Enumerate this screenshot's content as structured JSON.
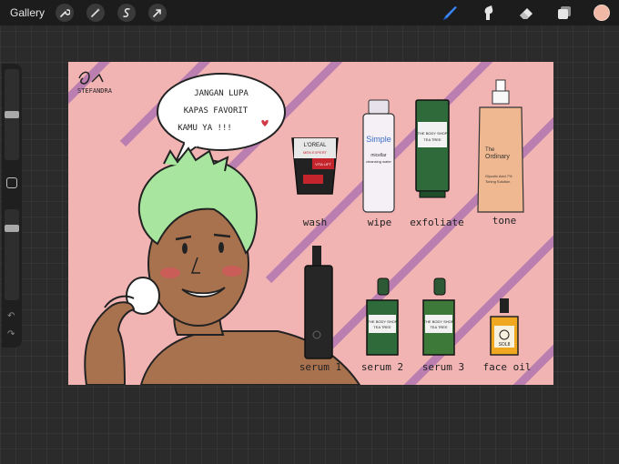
{
  "toolbar": {
    "gallery_label": "Gallery",
    "left_icons": [
      "wrench-icon",
      "magic-wand-icon",
      "selection-icon",
      "transform-arrow-icon"
    ],
    "right_icons": [
      "brush-icon",
      "smudge-icon",
      "eraser-icon",
      "layers-icon"
    ],
    "active_tool": "brush-icon",
    "current_color": "#f1b8a5"
  },
  "sidebar": {
    "brush_size_level": 0.5,
    "opacity_level": 0.82
  },
  "canvas": {
    "background": "#f2b3b3",
    "stripe_color": "#b57ab0",
    "signature": "STEFANDRA",
    "speech_bubble": {
      "line1": "JANGAN LUPA",
      "line2": "KAPAS FAVORIT",
      "line3": "KAMU YA !!!"
    },
    "products_top": [
      {
        "label": "wash",
        "text1": "L'OREAL",
        "text2": "MEN EXPERT",
        "text3": "VITA LIFT"
      },
      {
        "label": "wipe",
        "text1": "Simple",
        "text2": "micellar",
        "text3": "cleansing water"
      },
      {
        "label": "exfoliate",
        "text1": "THE BODY SHOP",
        "text2": "TEA TREE"
      },
      {
        "label": "tone",
        "text1": "The",
        "text2": "Ordinary",
        "text3": "Glycolic Acid 7%",
        "text4": "Toning Solution"
      }
    ],
    "products_bottom": [
      {
        "label": "serum 1"
      },
      {
        "label": "serum 2",
        "text1": "THE BODY SHOP",
        "text2": "TEA TREE"
      },
      {
        "label": "serum 3",
        "text1": "THE BODY SHOP",
        "text2": "TEA TREE"
      },
      {
        "label": "face oil",
        "text1": "SOL8"
      }
    ]
  }
}
